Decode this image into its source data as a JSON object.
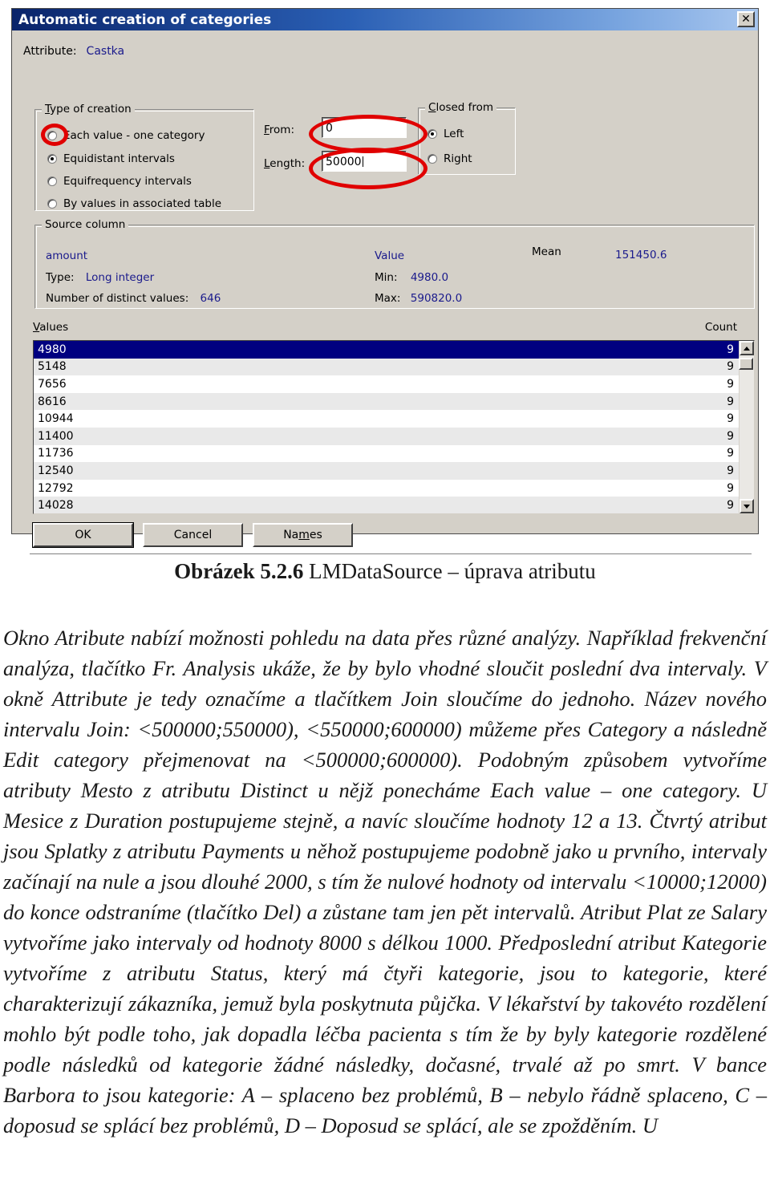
{
  "dialog": {
    "title": "Automatic creation of categories",
    "close_icon": "close-icon",
    "attribute_label": "Attribute:",
    "attribute_value": "Castka",
    "type_group": {
      "legend": "Type of creation",
      "legend_accel": "T",
      "options": [
        {
          "label": "Each value - one category",
          "selected": false
        },
        {
          "label": "Equidistant intervals",
          "selected": true
        },
        {
          "label": "Equifrequency intervals",
          "selected": false
        },
        {
          "label": "By values in associated table",
          "selected": false
        }
      ]
    },
    "from_label": "From:",
    "from_value": "0",
    "length_label": "Length:",
    "length_value": "50000",
    "closed_group": {
      "legend": "Closed from",
      "legend_accel": "C",
      "options": [
        {
          "label": "Left",
          "selected": true
        },
        {
          "label": "Right",
          "selected": false
        }
      ]
    },
    "source_group": {
      "legend": "Source column",
      "column_name": "amount",
      "type_label": "Type:",
      "type_value": "Long integer",
      "distinct_label": "Number of distinct values:",
      "distinct_value": "646",
      "value_label": "Value",
      "min_label": "Min:",
      "min_value": "4980.0",
      "max_label": "Max:",
      "max_value": "590820.0",
      "mean_label": "Mean",
      "mean_value": "151450.6"
    },
    "list": {
      "values_header": "Values",
      "count_header": "Count",
      "rows": [
        {
          "value": "4980",
          "count": "9",
          "selected": true
        },
        {
          "value": "5148",
          "count": "9",
          "selected": false
        },
        {
          "value": "7656",
          "count": "9",
          "selected": false
        },
        {
          "value": "8616",
          "count": "9",
          "selected": false
        },
        {
          "value": "10944",
          "count": "9",
          "selected": false
        },
        {
          "value": "11400",
          "count": "9",
          "selected": false
        },
        {
          "value": "11736",
          "count": "9",
          "selected": false
        },
        {
          "value": "12540",
          "count": "9",
          "selected": false
        },
        {
          "value": "12792",
          "count": "9",
          "selected": false
        },
        {
          "value": "14028",
          "count": "9",
          "selected": false
        }
      ],
      "scroll_up_icon": "arrow-up-icon",
      "scroll_down_icon": "arrow-down-icon"
    },
    "buttons": {
      "ok": "OK",
      "cancel": "Cancel",
      "names": "Names"
    },
    "annotation_color": "#e00000"
  },
  "caption": {
    "figure_number": "Obrázek 5.2.6",
    "figure_title": "LMDataSource – úprava atributu"
  },
  "body": {
    "text": "Okno Atribute nabízí možnosti pohledu na data přes různé analýzy. Například frekvenční analýza, tlačítko Fr. Analysis ukáže, že by bylo vhodné sloučit poslední dva intervaly. V okně Attribute je tedy označíme a tlačítkem Join sloučíme do jednoho. Název nového intervalu Join: <500000;550000), <550000;600000) můžeme přes Category a následně Edit category přejmenovat na <500000;600000). Podobným způsobem vytvoříme atributy Mesto z atributu Distinct u nějž ponecháme Each value – one category. U Mesice z Duration postupujeme stejně, a navíc sloučíme hodnoty 12 a 13. Čtvrtý atribut jsou Splatky z atributu Payments u něhož postupujeme podobně jako u prvního, intervaly začínají na nule a jsou dlouhé 2000, s tím že nulové hodnoty od intervalu <10000;12000) do konce odstraníme (tlačítko Del)  a zůstane tam jen pět intervalů. Atribut Plat ze Salary vytvoříme jako intervaly od hodnoty 8000 s délkou 1000. Předposlední atribut Kategorie vytvoříme z atributu Status, který má čtyři kategorie, jsou to kategorie, které charakterizují zákazníka, jemuž byla poskytnuta půjčka. V lékařství by takovéto rozdělení mohlo být podle toho, jak dopadla léčba pacienta s tím že by byly kategorie rozdělené podle následků od kategorie žádné následky, dočasné, trvalé až po smrt. V bance Barbora to jsou kategorie: A – splaceno bez problémů, B – nebylo řádně splaceno, C – doposud se splácí bez problémů, D – Doposud se splácí, ale se zpožděním. U"
  }
}
